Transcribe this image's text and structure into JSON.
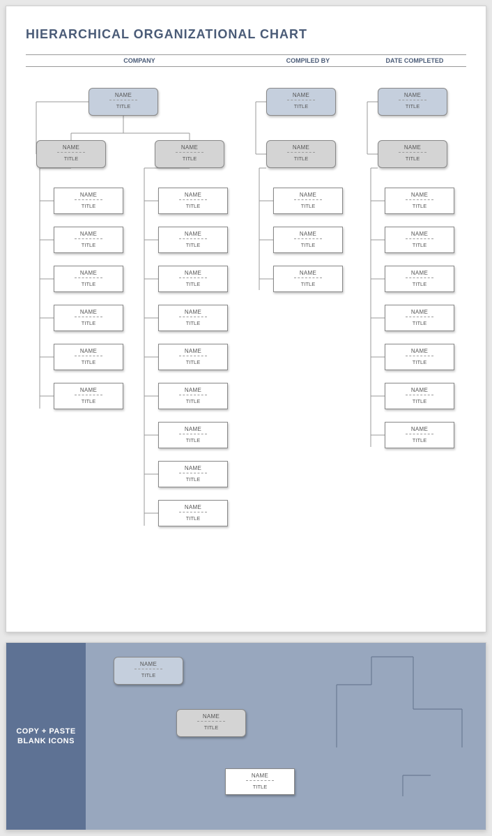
{
  "title": "HIERARCHICAL ORGANIZATIONAL CHART",
  "headers": {
    "company": "COMPANY",
    "compiled_by": "COMPILED BY",
    "date_completed": "DATE COMPLETED"
  },
  "node_defaults": {
    "name": "NAME",
    "title": "TITLE"
  },
  "panel2": {
    "label": "COPY + PASTE BLANK ICONS"
  },
  "chart_data": {
    "type": "org-chart",
    "root": {
      "name": "NAME",
      "title": "TITLE",
      "color": "blue",
      "children": [
        {
          "name": "NAME",
          "title": "TITLE",
          "color": "gray",
          "children": [
            {
              "name": "NAME",
              "title": "TITLE"
            },
            {
              "name": "NAME",
              "title": "TITLE"
            },
            {
              "name": "NAME",
              "title": "TITLE"
            },
            {
              "name": "NAME",
              "title": "TITLE"
            },
            {
              "name": "NAME",
              "title": "TITLE"
            },
            {
              "name": "NAME",
              "title": "TITLE"
            }
          ]
        },
        {
          "name": "NAME",
          "title": "TITLE",
          "color": "gray",
          "children": [
            {
              "name": "NAME",
              "title": "TITLE"
            },
            {
              "name": "NAME",
              "title": "TITLE"
            },
            {
              "name": "NAME",
              "title": "TITLE"
            },
            {
              "name": "NAME",
              "title": "TITLE"
            },
            {
              "name": "NAME",
              "title": "TITLE"
            },
            {
              "name": "NAME",
              "title": "TITLE"
            },
            {
              "name": "NAME",
              "title": "TITLE"
            },
            {
              "name": "NAME",
              "title": "TITLE"
            },
            {
              "name": "NAME",
              "title": "TITLE"
            }
          ]
        }
      ]
    },
    "siblings": [
      {
        "name": "NAME",
        "title": "TITLE",
        "color": "blue",
        "children": [
          {
            "name": "NAME",
            "title": "TITLE",
            "color": "gray",
            "children": [
              {
                "name": "NAME",
                "title": "TITLE"
              },
              {
                "name": "NAME",
                "title": "TITLE"
              },
              {
                "name": "NAME",
                "title": "TITLE"
              }
            ]
          }
        ]
      },
      {
        "name": "NAME",
        "title": "TITLE",
        "color": "blue",
        "children": [
          {
            "name": "NAME",
            "title": "TITLE",
            "color": "gray",
            "children": [
              {
                "name": "NAME",
                "title": "TITLE"
              },
              {
                "name": "NAME",
                "title": "TITLE"
              },
              {
                "name": "NAME",
                "title": "TITLE"
              },
              {
                "name": "NAME",
                "title": "TITLE"
              },
              {
                "name": "NAME",
                "title": "TITLE"
              },
              {
                "name": "NAME",
                "title": "TITLE"
              },
              {
                "name": "NAME",
                "title": "TITLE"
              }
            ]
          }
        ]
      }
    ],
    "palette_icons": [
      "blue",
      "gray",
      "white"
    ]
  }
}
